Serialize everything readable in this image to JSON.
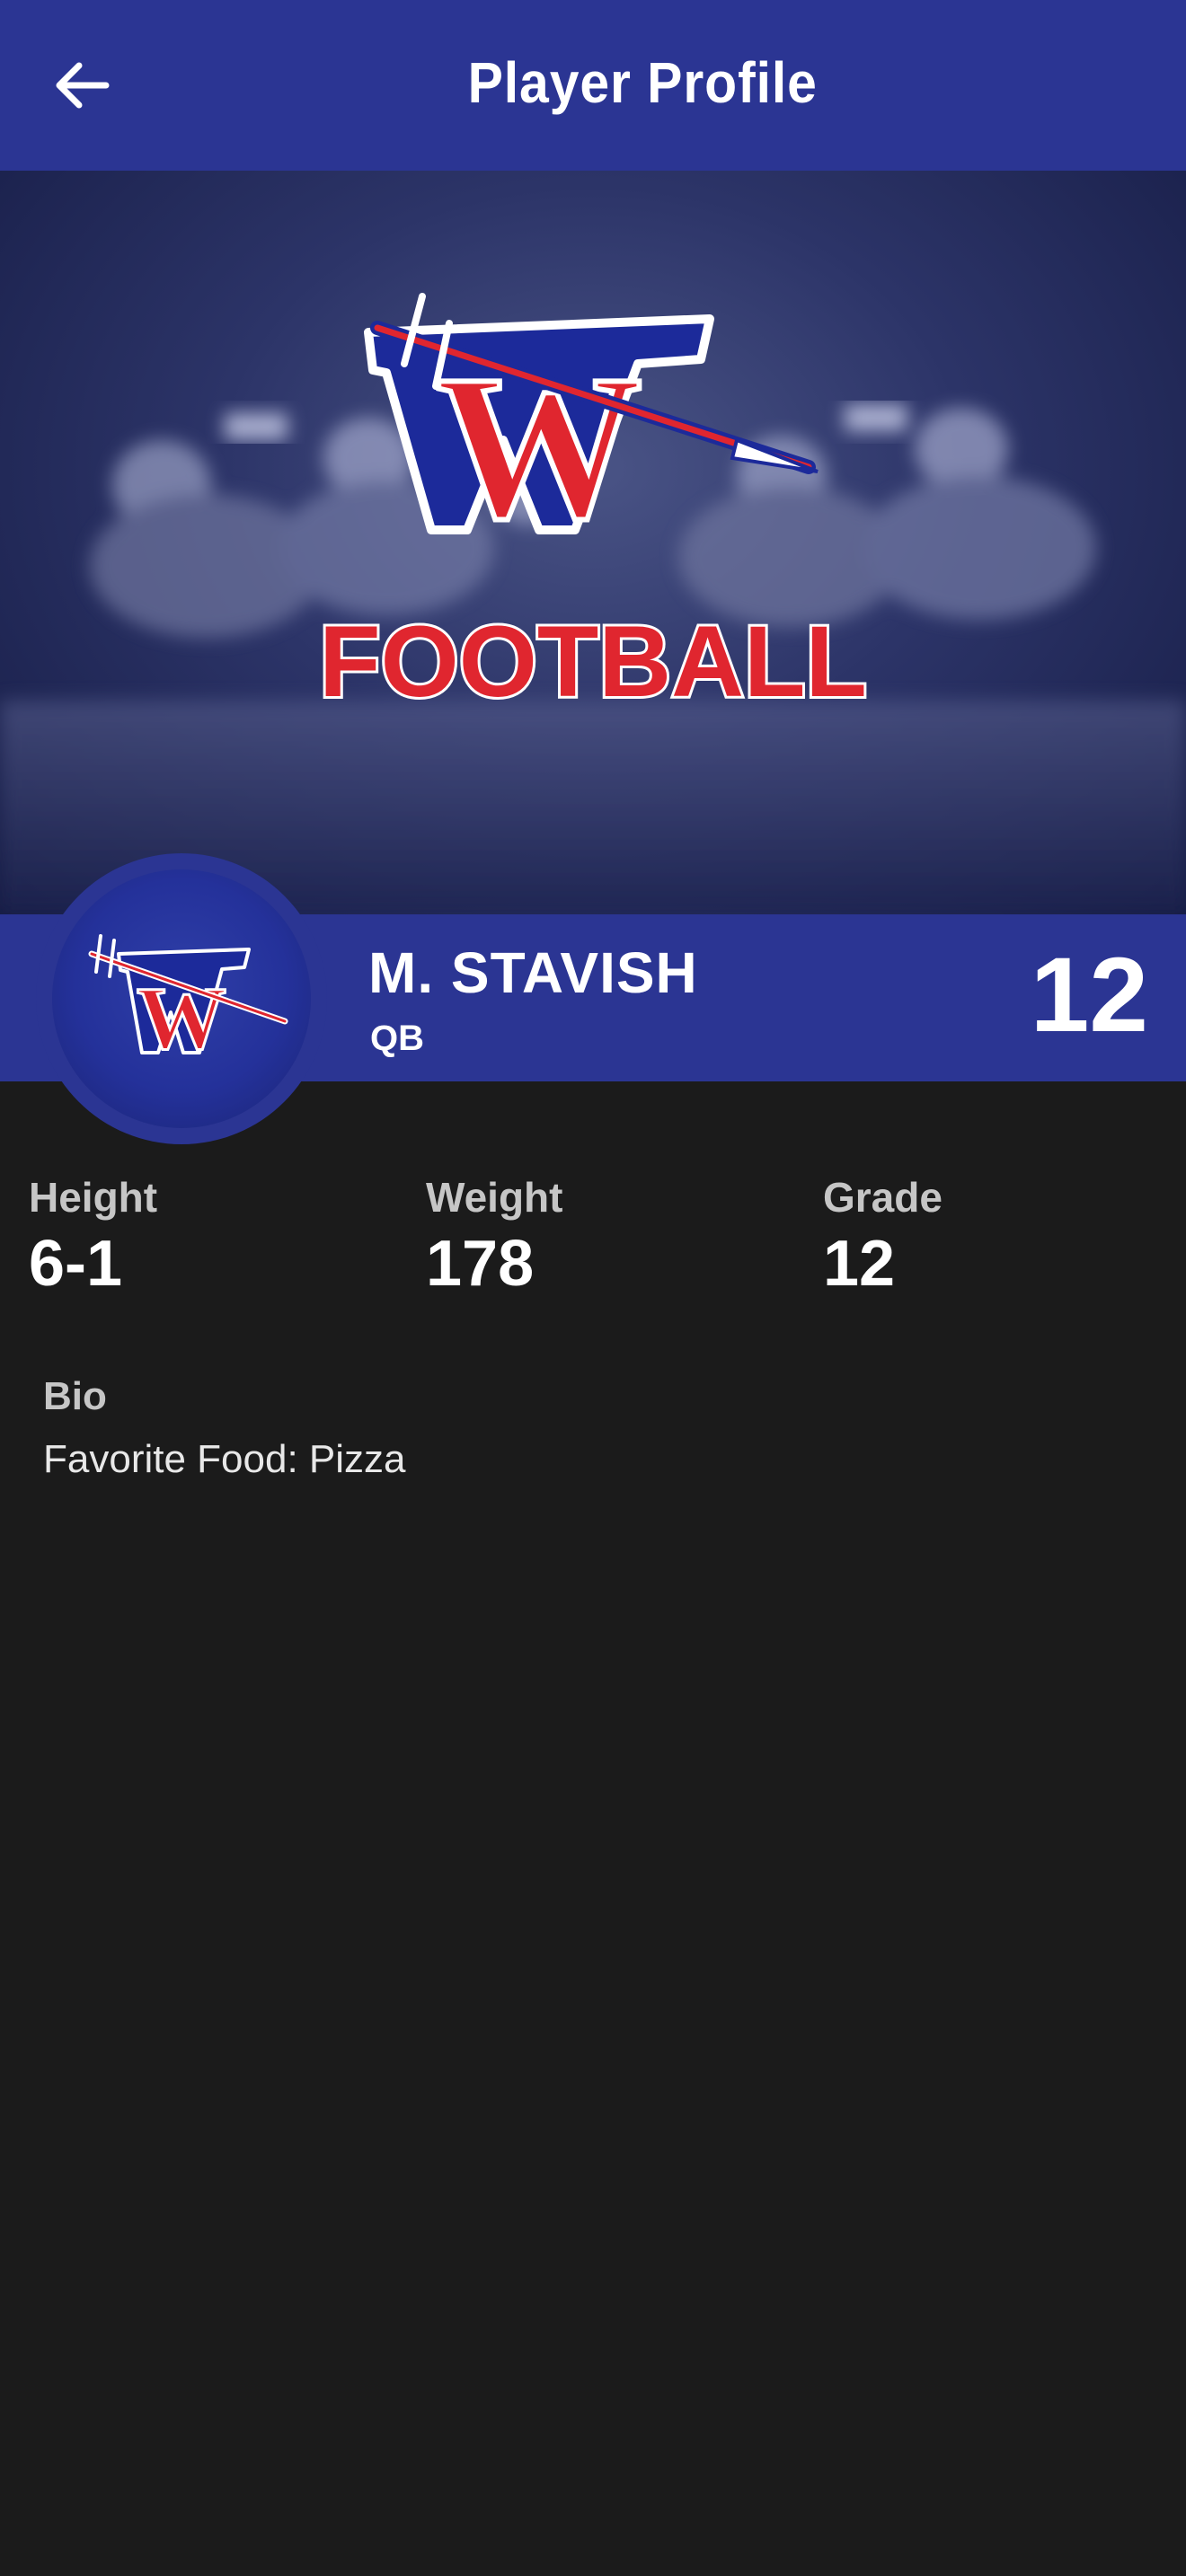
{
  "header": {
    "title": "Player Profile",
    "back_icon": "arrow-left-icon"
  },
  "banner": {
    "logo_letter": "W",
    "caption": "FOOTBALL"
  },
  "player": {
    "name": "M. STAVISH",
    "position": "QB",
    "number": "12",
    "avatar_letter": "W"
  },
  "stats": [
    {
      "label": "Height",
      "value": "6-1"
    },
    {
      "label": "Weight",
      "value": "178"
    },
    {
      "label": "Grade",
      "value": "12"
    }
  ],
  "bio": {
    "label": "Bio",
    "text": "Favorite Food: Pizza"
  },
  "colors": {
    "primary": "#2b3593",
    "background": "#1b1b1b",
    "accent_red": "#e0262f"
  }
}
